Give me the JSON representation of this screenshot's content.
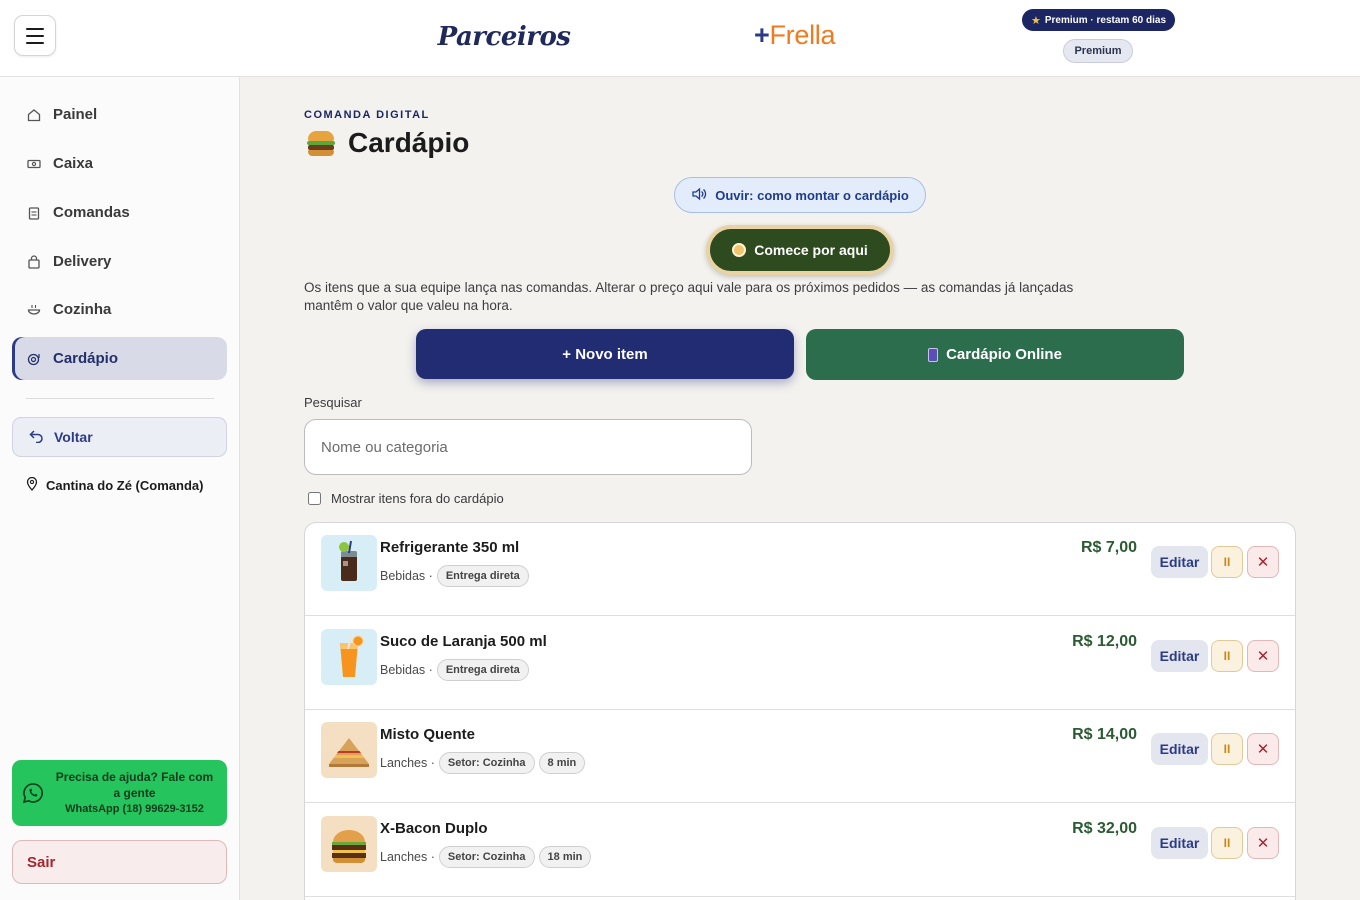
{
  "header": {
    "logo_parceiros": "Parceiros",
    "logo_frella_plus": "+",
    "logo_frella": "Frella",
    "premium_pill": "Premium · restam 60 dias",
    "premium_badge": "Premium"
  },
  "sidebar": {
    "items": [
      {
        "label": "Painel",
        "icon": "home-icon"
      },
      {
        "label": "Caixa",
        "icon": "cash-icon"
      },
      {
        "label": "Comandas",
        "icon": "clipboard-icon"
      },
      {
        "label": "Delivery",
        "icon": "bag-icon"
      },
      {
        "label": "Cozinha",
        "icon": "bowl-icon"
      },
      {
        "label": "Cardápio",
        "icon": "menu-icon",
        "active": true
      }
    ],
    "voltar_label": "Voltar",
    "venue": "Cantina do Zé (Comanda)",
    "help_line1": "Precisa de ajuda? Fale com a gente",
    "help_line2": "WhatsApp (18) 99629-3152",
    "sair_label": "Sair"
  },
  "main": {
    "eyebrow": "COMANDA DIGITAL",
    "title": "Cardápio",
    "ouvir_label": "Ouvir: como montar o cardápio",
    "comece_label": "Comece por aqui",
    "description": "Os itens que a sua equipe lança nas comandas. Alterar o preço aqui vale para os próximos pedidos — as comandas já lançadas mantêm o valor que valeu na hora.",
    "novo_item_label": "+ Novo item",
    "cardapio_online_label": "Cardápio Online",
    "search_label": "Pesquisar",
    "search_placeholder": "Nome ou categoria",
    "fora_label": "Mostrar itens fora do cardápio",
    "edit_label": "Editar",
    "pause_glyph": "II",
    "delete_glyph": "✕",
    "items": [
      {
        "name": "Refrigerante 350 ml",
        "category": "Bebidas ·",
        "chips": [
          "Entrega direta"
        ],
        "price": "R$ 7,00"
      },
      {
        "name": "Suco de Laranja 500 ml",
        "category": "Bebidas ·",
        "chips": [
          "Entrega direta"
        ],
        "price": "R$ 12,00"
      },
      {
        "name": "Misto Quente",
        "category": "Lanches ·",
        "chips": [
          "Setor: Cozinha",
          "8 min"
        ],
        "price": "R$ 14,00"
      },
      {
        "name": "X-Bacon Duplo",
        "category": "Lanches ·",
        "chips": [
          "Setor: Cozinha",
          "18 min"
        ],
        "price": "R$ 32,00"
      }
    ]
  },
  "colors": {
    "brand_navy": "#222c73",
    "online_green": "#2c6d4e",
    "whatsapp_green": "#25c45c",
    "price_green": "#2c5a32",
    "danger_red": "#a3282f"
  }
}
